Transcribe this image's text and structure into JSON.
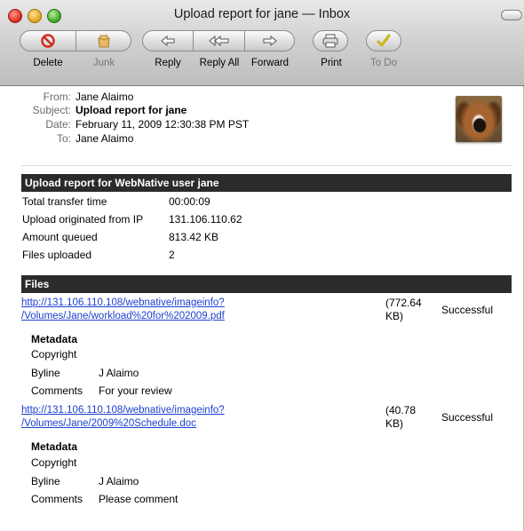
{
  "window": {
    "title": "Upload report for jane — Inbox"
  },
  "toolbar": {
    "delete": {
      "label": "Delete",
      "icon": "no-entry-icon"
    },
    "junk": {
      "label": "Junk",
      "icon": "junk-bag-icon"
    },
    "reply": {
      "label": "Reply",
      "icon": "reply-arrow-icon"
    },
    "reply_all": {
      "label": "Reply All",
      "icon": "reply-all-arrow-icon"
    },
    "forward": {
      "label": "Forward",
      "icon": "forward-arrow-icon"
    },
    "print": {
      "label": "Print",
      "icon": "printer-icon"
    },
    "todo": {
      "label": "To Do",
      "icon": "checkmark-icon"
    }
  },
  "header": {
    "from_label": "From:",
    "from": "Jane Alaimo",
    "subject_label": "Subject:",
    "subject": "Upload report for jane",
    "date_label": "Date:",
    "date": "February 11, 2009 12:30:38 PM PST",
    "to_label": "To:",
    "to": "Jane Alaimo"
  },
  "report": {
    "title": "Upload report for WebNative user jane",
    "rows": [
      {
        "key": "Total transfer time",
        "value": "00:00:09"
      },
      {
        "key": "Upload originated from IP",
        "value": "131.106.110.62"
      },
      {
        "key": "Amount queued",
        "value": "813.42 KB"
      },
      {
        "key": "Files uploaded",
        "value": "2"
      }
    ]
  },
  "files": {
    "title": "Files",
    "items": [
      {
        "link_line1": "http://131.106.110.108/webnative/imageinfo?",
        "link_line2": "/Volumes/Jane/workload%20for%202009.pdf",
        "size_line1": "(772.64",
        "size_line2": "KB)",
        "status": "Successful",
        "metadata_title": "Metadata",
        "copyright_label": "Copyright",
        "byline_label": "Byline",
        "byline": "J Alaimo",
        "comments_label": "Comments",
        "comments": "For your review"
      },
      {
        "link_line1": "http://131.106.110.108/webnative/imageinfo?",
        "link_line2": "/Volumes/Jane/2009%20Schedule.doc",
        "size_line1": "(40.78",
        "size_line2": "KB)",
        "status": "Successful",
        "metadata_title": "Metadata",
        "copyright_label": "Copyright",
        "byline_label": "Byline",
        "byline": "J Alaimo",
        "comments_label": "Comments",
        "comments": "Please comment"
      }
    ]
  },
  "colors": {
    "link": "#1c3fd0",
    "section_bar": "#2b2b2b",
    "delete_icon": "#d42a1c",
    "todo_icon": "#c9b51a"
  }
}
